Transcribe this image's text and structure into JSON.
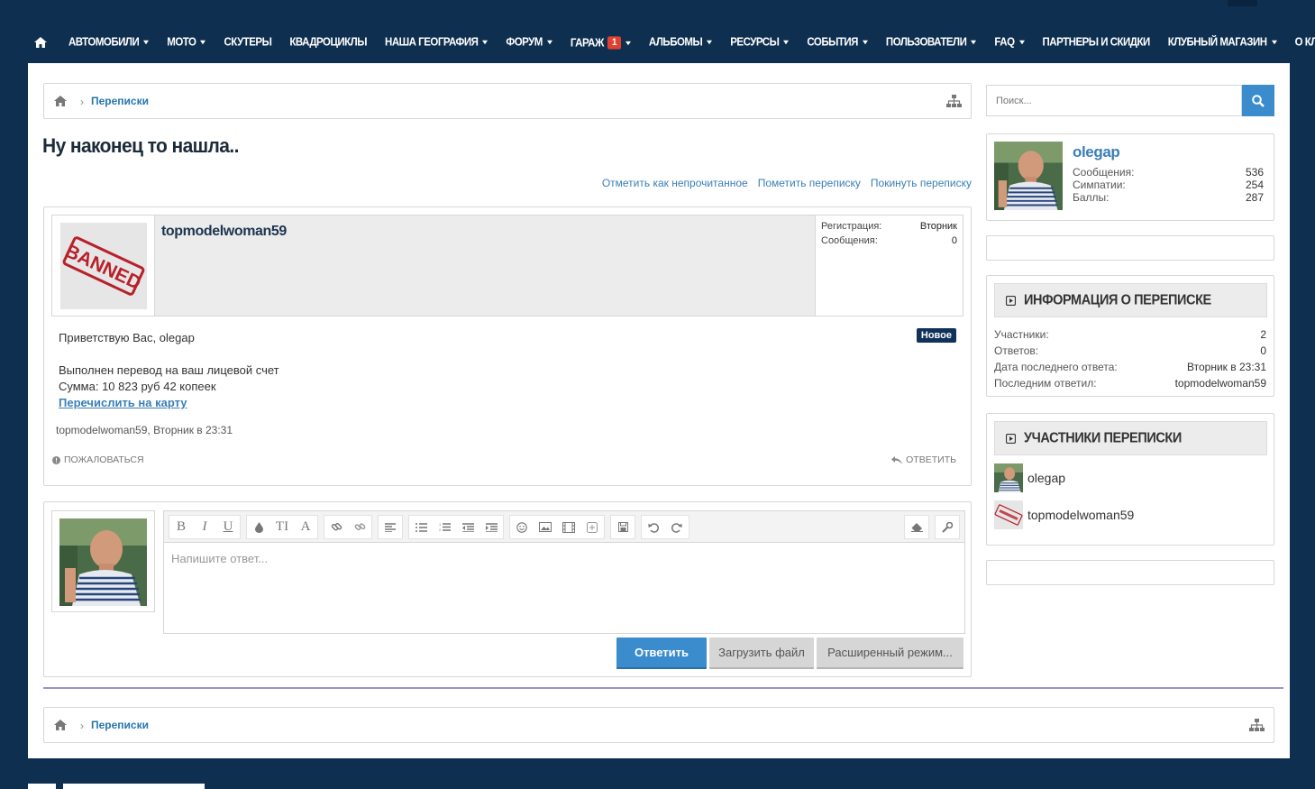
{
  "nav": {
    "items": [
      {
        "label": "АВТОМОБИЛИ",
        "caret": true
      },
      {
        "label": "МОТО",
        "caret": true
      },
      {
        "label": "СКУТЕРЫ",
        "caret": false
      },
      {
        "label": "КВАДРОЦИКЛЫ",
        "caret": false
      },
      {
        "label": "НАША ГЕОГРАФИЯ",
        "caret": true
      },
      {
        "label": "ФОРУМ",
        "caret": true
      },
      {
        "label": "ГАРАЖ",
        "caret": true,
        "badge": "1"
      },
      {
        "label": "АЛЬБОМЫ",
        "caret": true
      },
      {
        "label": "РЕСУРСЫ",
        "caret": true
      },
      {
        "label": "СОБЫТИЯ",
        "caret": true
      },
      {
        "label": "ПОЛЬЗОВАТЕЛИ",
        "caret": true
      },
      {
        "label": "FAQ",
        "caret": true
      },
      {
        "label": "ПАРТНЕРЫ И СКИДКИ",
        "caret": false
      },
      {
        "label": "КЛУБНЫЙ МАГАЗИН",
        "caret": true
      },
      {
        "label": "О КЛУБЕ",
        "caret": true
      }
    ]
  },
  "breadcrumb": {
    "label": "Переписки"
  },
  "search": {
    "placeholder": "Поиск..."
  },
  "page": {
    "title": "Ну наконец то нашла.."
  },
  "actions": {
    "mark_unread": "Отметить как непрочитанное",
    "star": "Пометить переписку",
    "leave": "Покинуть переписку"
  },
  "message": {
    "username": "topmodelwoman59",
    "avatar_stamp": "BANNED",
    "reg_label": "Регистрация:",
    "reg_value": "Вторник",
    "posts_label": "Сообщения:",
    "posts_value": "0",
    "greeting": "Приветствую Вас, olegap",
    "line1": "Выполнен перевод на ваш лицевой счет",
    "line2": "Сумма: 10 823 руб 42 копеек",
    "link": "Перечислить на карту",
    "new_badge": "Новое",
    "meta": "topmodelwoman59, Вторник в 23:31",
    "report": "ПОЖАЛОВАТЬСЯ",
    "reply": "ОТВЕТИТЬ"
  },
  "reply_form": {
    "placeholder": "Напишите ответ...",
    "submit": "Ответить",
    "upload": "Загрузить файл",
    "advanced": "Расширенный режим..."
  },
  "visitor": {
    "name": "olegap",
    "messages_label": "Сообщения:",
    "messages_value": "536",
    "likes_label": "Симпатии:",
    "likes_value": "254",
    "points_label": "Баллы:",
    "points_value": "287"
  },
  "conv_info": {
    "title": "ИНФОРМАЦИЯ О ПЕРЕПИСКЕ",
    "participants_label": "Участники:",
    "participants_value": "2",
    "replies_label": "Ответов:",
    "replies_value": "0",
    "last_reply_date_label": "Дата последнего ответа:",
    "last_reply_date_value": "Вторник в 23:31",
    "last_reply_by_label": "Последним ответил:",
    "last_reply_by_value": "topmodelwoman59"
  },
  "participants": {
    "title": "УЧАСТНИКИ ПЕРЕПИСКИ",
    "list": [
      "olegap",
      "topmodelwoman59"
    ]
  },
  "colors": {
    "nav_bg": "#0e2f4f",
    "accent": "#3b8ccc",
    "link": "#3a7fb7",
    "badge_new": "#10325a",
    "alert_badge": "#e0402f"
  }
}
